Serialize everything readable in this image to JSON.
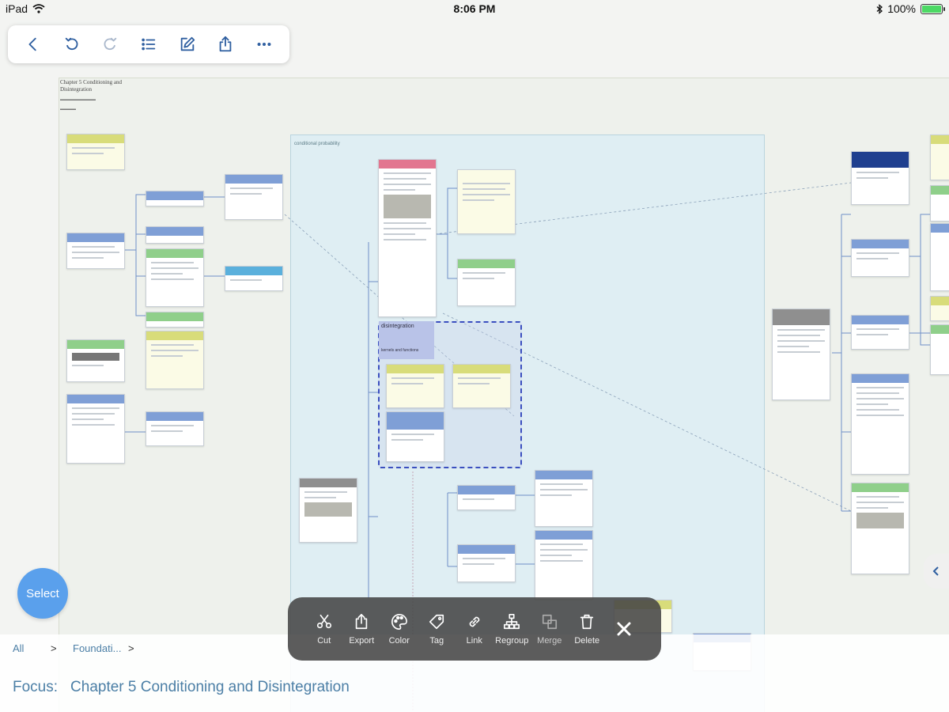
{
  "status": {
    "device": "iPad",
    "time": "8:06 PM",
    "battery": "100%",
    "battery_level": 1.0
  },
  "toolbar": {
    "buttons": [
      {
        "name": "back-button",
        "icon": "chevron-left-icon"
      },
      {
        "name": "undo-button",
        "icon": "undo-icon"
      },
      {
        "name": "redo-button",
        "icon": "redo-icon"
      },
      {
        "name": "outline-button",
        "icon": "list-icon"
      },
      {
        "name": "edit-button",
        "icon": "pencil-square-icon"
      },
      {
        "name": "share-button",
        "icon": "share-icon"
      },
      {
        "name": "more-button",
        "icon": "ellipsis-icon"
      }
    ]
  },
  "canvas": {
    "chapter_title": "Chapter 5 Conditioning and Disintegration",
    "group_label": "conditional probability",
    "selected_note": "disintegration",
    "selected_note_sub": "kernels and functions"
  },
  "select_button": "Select",
  "breadcrumb": {
    "root": "All",
    "sep": ">",
    "item": "Foundati...",
    "sep2": ">"
  },
  "focus": {
    "label": "Focus:",
    "title": "Chapter 5 Conditioning and Disintegration"
  },
  "edit_toolbar": {
    "tools": [
      {
        "label": "Cut",
        "icon": "scissors-icon"
      },
      {
        "label": "Export",
        "icon": "export-icon"
      },
      {
        "label": "Color",
        "icon": "palette-icon"
      },
      {
        "label": "Tag",
        "icon": "tag-icon"
      },
      {
        "label": "Link",
        "icon": "link-icon"
      },
      {
        "label": "Regroup",
        "icon": "regroup-icon"
      },
      {
        "label": "Merge",
        "icon": "merge-icon"
      },
      {
        "label": "Delete",
        "icon": "trash-icon"
      }
    ],
    "close_icon": "close-icon"
  }
}
